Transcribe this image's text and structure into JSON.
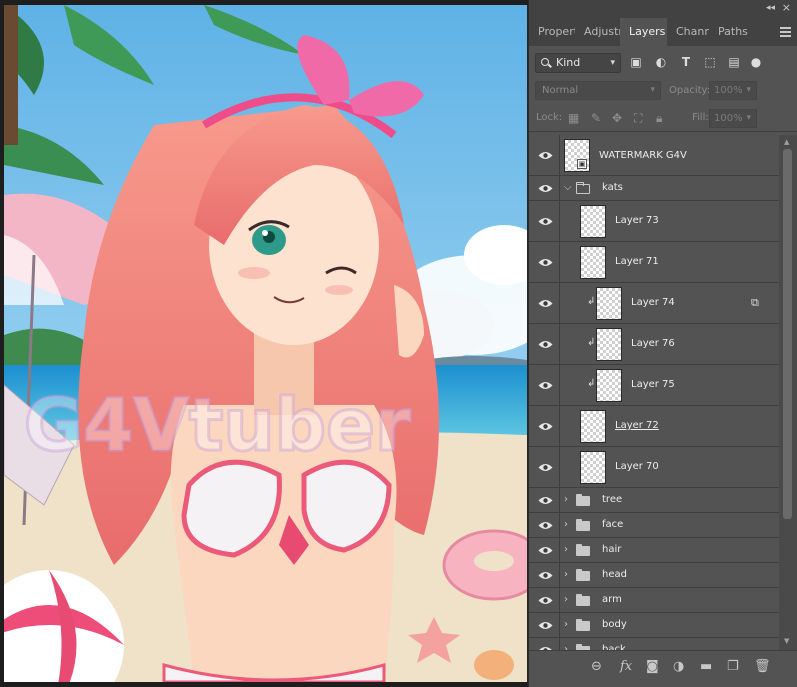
{
  "panel": {
    "tabs": [
      {
        "label": "Propert",
        "active": false
      },
      {
        "label": "Adjustn",
        "active": false
      },
      {
        "label": "Layers",
        "active": true
      },
      {
        "label": "Channe",
        "active": false
      },
      {
        "label": "Paths",
        "active": false
      }
    ],
    "filter": {
      "kind_label": "Kind"
    },
    "blend_mode": "Normal",
    "opacity_label": "Opacity:",
    "opacity_value": "100%",
    "lock_label": "Lock:",
    "fill_label": "Fill:",
    "fill_value": "100%"
  },
  "layers": [
    {
      "name": "WATERMARK G4V",
      "type": "smart"
    },
    {
      "name": "kats",
      "type": "group-open"
    },
    {
      "name": "Layer 73",
      "type": "pixel"
    },
    {
      "name": "Layer 71",
      "type": "pixel"
    },
    {
      "name": "Layer 74",
      "type": "clipped"
    },
    {
      "name": "Layer 76",
      "type": "clipped"
    },
    {
      "name": "Layer 75",
      "type": "clipped"
    },
    {
      "name": "Layer 72",
      "type": "pixel"
    },
    {
      "name": "Layer 70",
      "type": "pixel"
    },
    {
      "name": "tree",
      "type": "group"
    },
    {
      "name": "face",
      "type": "group"
    },
    {
      "name": "hair",
      "type": "group"
    },
    {
      "name": "head",
      "type": "group"
    },
    {
      "name": "arm",
      "type": "group"
    },
    {
      "name": "body",
      "type": "group"
    },
    {
      "name": "back",
      "type": "group"
    }
  ],
  "canvas": {
    "watermark_text": "G4Vtuber"
  },
  "colors": {
    "panel_bg": "#535353",
    "tab_bar_bg": "#424242",
    "hair": "#f08a80",
    "bow": "#f06aa8",
    "sky": "#7fc7ea",
    "sea": "#2aa6d8"
  }
}
